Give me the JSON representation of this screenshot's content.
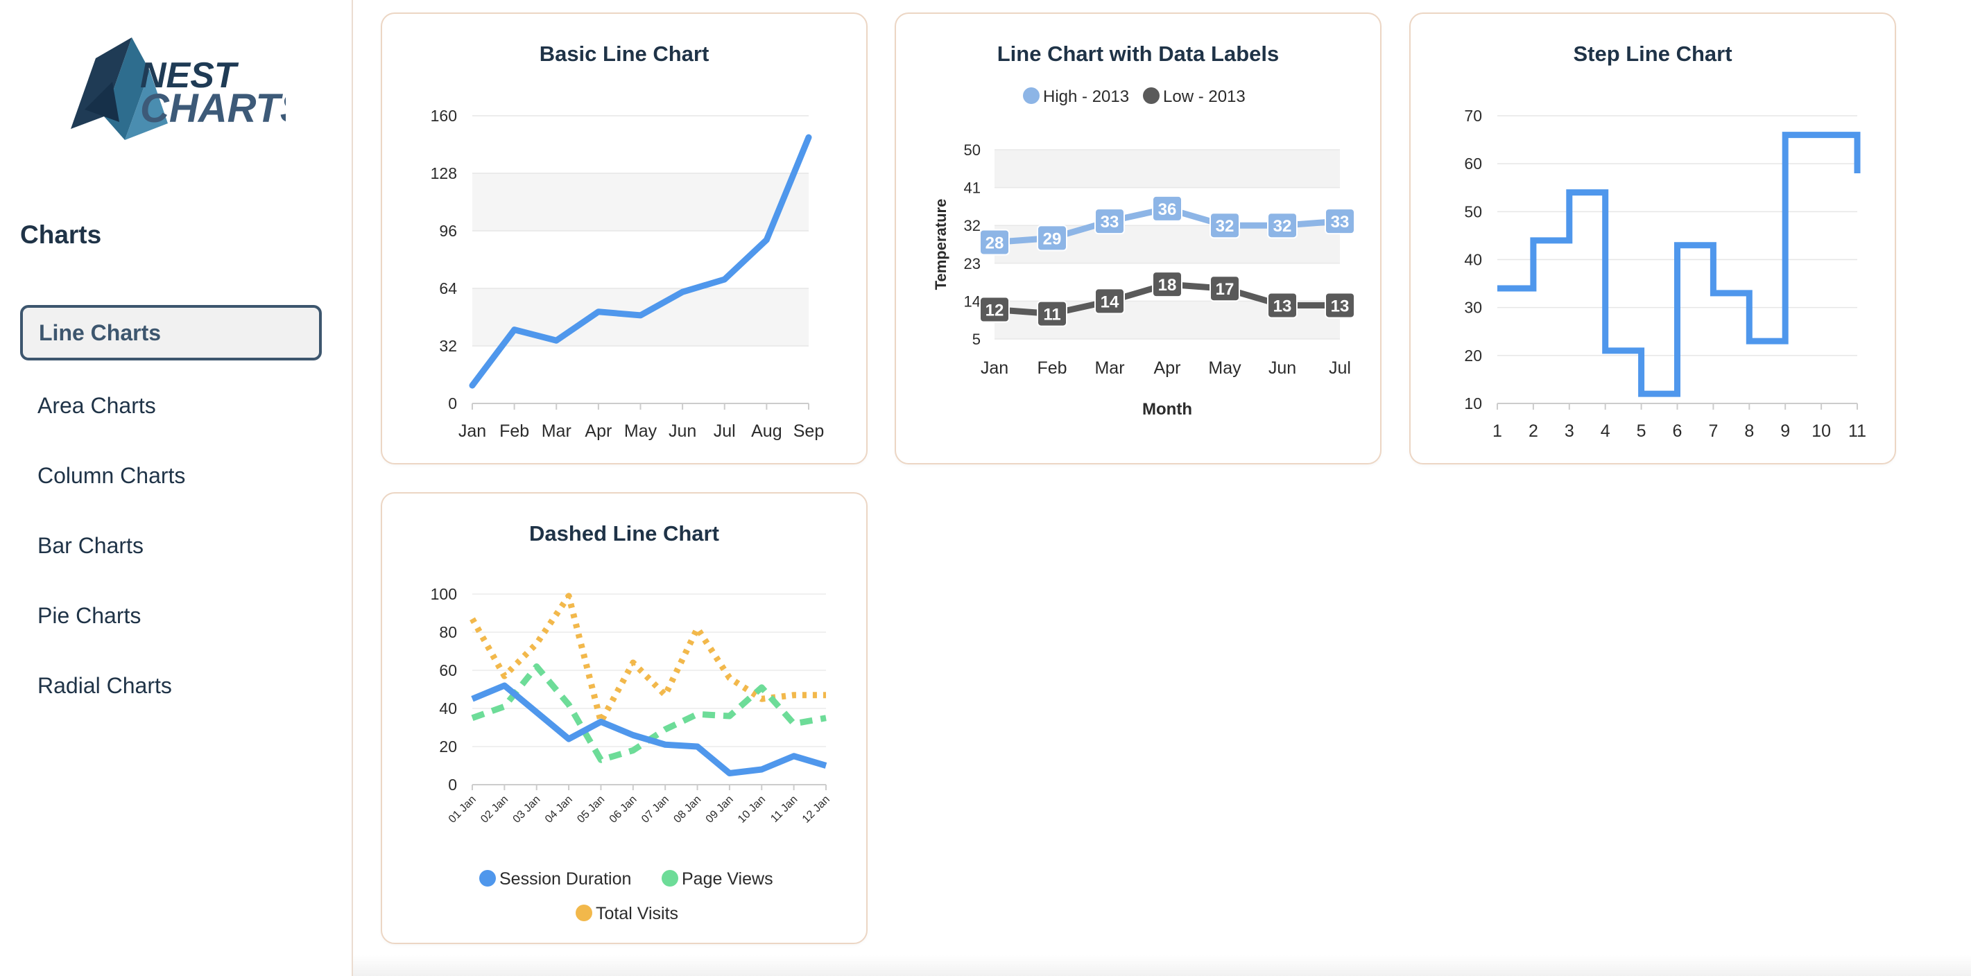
{
  "sidebar": {
    "logo": {
      "line1": "NEST",
      "line2": "CHARTS",
      "colors": {
        "dark": "#1f3b55",
        "mid": "#2e6d8e",
        "light": "#4a8db0"
      }
    },
    "title": "Charts",
    "items": [
      {
        "label": "Line Charts",
        "active": true
      },
      {
        "label": "Area Charts",
        "active": false
      },
      {
        "label": "Column Charts",
        "active": false
      },
      {
        "label": "Bar Charts",
        "active": false
      },
      {
        "label": "Pie Charts",
        "active": false
      },
      {
        "label": "Radial Charts",
        "active": false
      }
    ]
  },
  "cards": {
    "basic": {
      "title": "Basic Line Chart"
    },
    "labels": {
      "title": "Line Chart with Data Labels"
    },
    "step": {
      "title": "Step Line Chart"
    },
    "dashed": {
      "title": "Dashed Line Chart"
    }
  },
  "chart_data": [
    {
      "type": "line",
      "title": "Basic Line Chart",
      "categories": [
        "Jan",
        "Feb",
        "Mar",
        "Apr",
        "May",
        "Jun",
        "Jul",
        "Aug",
        "Sep"
      ],
      "series": [
        {
          "values": [
            10,
            41,
            35,
            51,
            49,
            62,
            69,
            91,
            148
          ]
        }
      ],
      "yticks": [
        0,
        32,
        64,
        96,
        128,
        160
      ],
      "ylim": [
        0,
        160
      ],
      "grid": true,
      "colors": [
        "#4f97ec"
      ]
    },
    {
      "type": "line",
      "title": "Line Chart with Data Labels",
      "categories": [
        "Jan",
        "Feb",
        "Mar",
        "Apr",
        "May",
        "Jun",
        "Jul"
      ],
      "series": [
        {
          "name": "High - 2013",
          "values": [
            28,
            29,
            33,
            36,
            32,
            32,
            33
          ]
        },
        {
          "name": "Low - 2013",
          "values": [
            12,
            11,
            14,
            18,
            17,
            13,
            13
          ]
        }
      ],
      "yticks": [
        5,
        14,
        23,
        32,
        41,
        50
      ],
      "ylim": [
        5,
        50
      ],
      "xlabel": "Month",
      "ylabel": "Temperature",
      "legend": "top-center",
      "data_labels": true,
      "colors": [
        "#8db5e6",
        "#5a5a5a"
      ]
    },
    {
      "type": "line",
      "subtype": "step",
      "title": "Step Line Chart",
      "x": [
        1,
        2,
        3,
        4,
        5,
        6,
        7,
        8,
        9,
        10,
        11
      ],
      "series": [
        {
          "values": [
            34,
            44,
            54,
            21,
            12,
            43,
            33,
            23,
            66,
            66,
            58
          ]
        }
      ],
      "yticks": [
        10,
        20,
        30,
        40,
        50,
        60,
        70
      ],
      "ylim": [
        10,
        70
      ],
      "grid": true,
      "colors": [
        "#4f97ec"
      ]
    },
    {
      "type": "line",
      "title": "Dashed Line Chart",
      "categories": [
        "01 Jan",
        "02 Jan",
        "03 Jan",
        "04 Jan",
        "05 Jan",
        "06 Jan",
        "07 Jan",
        "08 Jan",
        "09 Jan",
        "10 Jan",
        "11 Jan",
        "12 Jan"
      ],
      "series": [
        {
          "name": "Session Duration",
          "values": [
            45,
            52,
            38,
            24,
            33,
            26,
            21,
            20,
            6,
            8,
            15,
            10
          ],
          "dash": "solid"
        },
        {
          "name": "Page Views",
          "values": [
            35,
            41,
            62,
            42,
            13,
            18,
            29,
            37,
            36,
            51,
            32,
            35
          ],
          "dash": "dashed"
        },
        {
          "name": "Total Visits",
          "values": [
            87,
            57,
            74,
            99,
            33,
            64,
            47,
            82,
            56,
            45,
            47,
            47
          ],
          "dash": "dotted"
        }
      ],
      "yticks": [
        0,
        20,
        40,
        60,
        80,
        100
      ],
      "ylim": [
        0,
        100
      ],
      "legend": "bottom",
      "colors": [
        "#4f97ec",
        "#6ddc98",
        "#f2b84b"
      ]
    }
  ]
}
